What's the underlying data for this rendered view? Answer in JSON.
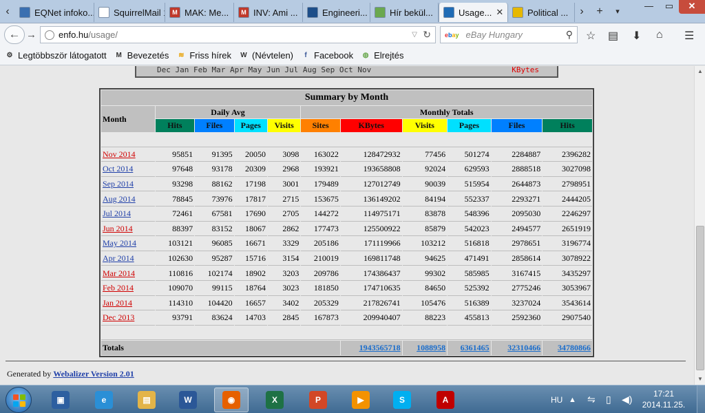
{
  "browser": {
    "tabs": [
      {
        "label": "EQNet infoko...",
        "fav_color": "#3a6fb0",
        "fav_text": ""
      },
      {
        "label": "SquirrelMail 1...",
        "fav_color": "#ffffff",
        "fav_text": ""
      },
      {
        "label": "MAK: Me...",
        "fav_color": "#c0392b",
        "fav_text": "M"
      },
      {
        "label": "INV: Ami ...",
        "fav_color": "#c0392b",
        "fav_text": "M"
      },
      {
        "label": "Engineeri...",
        "fav_color": "#1d4e89",
        "fav_text": ""
      },
      {
        "label": "Hír bekül...",
        "fav_color": "#6aa84f",
        "fav_text": ""
      },
      {
        "label": "Usage...",
        "fav_color": "#1f6bb5",
        "fav_text": ""
      },
      {
        "label": "Political ...",
        "fav_color": "#e6b800",
        "fav_text": ""
      }
    ],
    "url_host": "enfo.hu",
    "url_path": "/usage/",
    "search_engine_logo": "ebay",
    "search_placeholder": "eBay Hungary",
    "bookmarks": [
      {
        "label": "Legtöbbször látogatott",
        "icon": "gear-icon",
        "color": "#333333",
        "glyph": "⚙"
      },
      {
        "label": "Bevezetés",
        "icon": "m-logo-icon",
        "color": "#333333",
        "glyph": "M"
      },
      {
        "label": "Friss hírek",
        "icon": "rss-icon",
        "color": "#e8a000",
        "glyph": "≋"
      },
      {
        "label": "(Névtelen)",
        "icon": "w-logo-icon",
        "color": "#333333",
        "glyph": "W"
      },
      {
        "label": "Facebook",
        "icon": "facebook-icon",
        "color": "#3b5998",
        "glyph": "f"
      },
      {
        "label": "Elrejtés",
        "icon": "hide-icon",
        "color": "#6aa84f",
        "glyph": "◍"
      }
    ]
  },
  "page": {
    "graph_strip_months": "Dec Jan Feb Mar Apr May Jun Jul Aug Sep Oct Nov",
    "graph_strip_kbytes": "KBytes",
    "summary": {
      "title": "Summary by Month",
      "month_header": "Month",
      "daily_avg_header": "Daily Avg",
      "monthly_totals_header": "Monthly Totals",
      "daily_columns": [
        {
          "label": "Hits",
          "color": "#00805c"
        },
        {
          "label": "Files",
          "color": "#0080ff"
        },
        {
          "label": "Pages",
          "color": "#00e0ff"
        },
        {
          "label": "Visits",
          "color": "#ffff00"
        }
      ],
      "monthly_columns": [
        {
          "label": "Sites",
          "color": "#ff8000"
        },
        {
          "label": "KBytes",
          "color": "#ff0000"
        },
        {
          "label": "Visits",
          "color": "#ffff00"
        },
        {
          "label": "Pages",
          "color": "#00e0ff"
        },
        {
          "label": "Files",
          "color": "#0080ff"
        },
        {
          "label": "Hits",
          "color": "#00805c"
        }
      ],
      "rows": [
        {
          "month": "Nov 2014",
          "link_color": "#d00000",
          "cells": [
            "95851",
            "91395",
            "20050",
            "3098",
            "163022",
            "128472932",
            "77456",
            "501274",
            "2284887",
            "2396282"
          ]
        },
        {
          "month": "Oct 2014",
          "link_color": "#1f3fa8",
          "cells": [
            "97648",
            "93178",
            "20309",
            "2968",
            "193921",
            "193658808",
            "92024",
            "629593",
            "2888518",
            "3027098"
          ]
        },
        {
          "month": "Sep 2014",
          "link_color": "#1f3fa8",
          "cells": [
            "93298",
            "88162",
            "17198",
            "3001",
            "179489",
            "127012749",
            "90039",
            "515954",
            "2644873",
            "2798951"
          ]
        },
        {
          "month": "Aug 2014",
          "link_color": "#1f3fa8",
          "cells": [
            "78845",
            "73976",
            "17817",
            "2715",
            "153675",
            "136149202",
            "84194",
            "552337",
            "2293271",
            "2444205"
          ]
        },
        {
          "month": "Jul 2014",
          "link_color": "#1f3fa8",
          "cells": [
            "72461",
            "67581",
            "17690",
            "2705",
            "144272",
            "114975171",
            "83878",
            "548396",
            "2095030",
            "2246297"
          ]
        },
        {
          "month": "Jun 2014",
          "link_color": "#d00000",
          "cells": [
            "88397",
            "83152",
            "18067",
            "2862",
            "177473",
            "125500922",
            "85879",
            "542023",
            "2494577",
            "2651919"
          ]
        },
        {
          "month": "May 2014",
          "link_color": "#1f3fa8",
          "cells": [
            "103121",
            "96085",
            "16671",
            "3329",
            "205186",
            "171119966",
            "103212",
            "516818",
            "2978651",
            "3196774"
          ]
        },
        {
          "month": "Apr 2014",
          "link_color": "#1f3fa8",
          "cells": [
            "102630",
            "95287",
            "15716",
            "3154",
            "210019",
            "169811748",
            "94625",
            "471491",
            "2858614",
            "3078922"
          ]
        },
        {
          "month": "Mar 2014",
          "link_color": "#d00000",
          "cells": [
            "110816",
            "102174",
            "18902",
            "3203",
            "209786",
            "174386437",
            "99302",
            "585985",
            "3167415",
            "3435297"
          ]
        },
        {
          "month": "Feb 2014",
          "link_color": "#d00000",
          "cells": [
            "109070",
            "99115",
            "18764",
            "3023",
            "181850",
            "174710635",
            "84650",
            "525392",
            "2775246",
            "3053967"
          ]
        },
        {
          "month": "Jan 2014",
          "link_color": "#d00000",
          "cells": [
            "114310",
            "104420",
            "16657",
            "3402",
            "205329",
            "217826741",
            "105476",
            "516389",
            "3237024",
            "3543614"
          ]
        },
        {
          "month": "Dec 2013",
          "link_color": "#d00000",
          "cells": [
            "93791",
            "83624",
            "14703",
            "2845",
            "167873",
            "209940407",
            "88223",
            "455813",
            "2592360",
            "2907540"
          ]
        }
      ],
      "totals_label": "Totals",
      "totals": [
        "1943565718",
        "1088958",
        "6361465",
        "32310466",
        "34780866"
      ]
    },
    "generated_by_prefix": "Generated by",
    "generated_by_link": "Webalizer Version 2.01"
  },
  "taskbar": {
    "apps": [
      {
        "name": "floppy-save-app",
        "color": "#2d5fa0",
        "glyph": "▣"
      },
      {
        "name": "internet-explorer-app",
        "color": "#2a8fd6",
        "glyph": "e"
      },
      {
        "name": "file-explorer-app",
        "color": "#e3b448",
        "glyph": "▤"
      },
      {
        "name": "word-app",
        "color": "#2b5797",
        "glyph": "W"
      },
      {
        "name": "firefox-app",
        "color": "#e66000",
        "glyph": "◉"
      },
      {
        "name": "excel-app",
        "color": "#1e7145",
        "glyph": "X"
      },
      {
        "name": "powerpoint-app",
        "color": "#d24726",
        "glyph": "P"
      },
      {
        "name": "media-player-app",
        "color": "#f39200",
        "glyph": "▶"
      },
      {
        "name": "skype-app",
        "color": "#00aff0",
        "glyph": "S"
      },
      {
        "name": "acrobat-app",
        "color": "#c00000",
        "glyph": "A"
      }
    ],
    "language": "HU",
    "time": "17:21",
    "date": "2014.11.25."
  }
}
